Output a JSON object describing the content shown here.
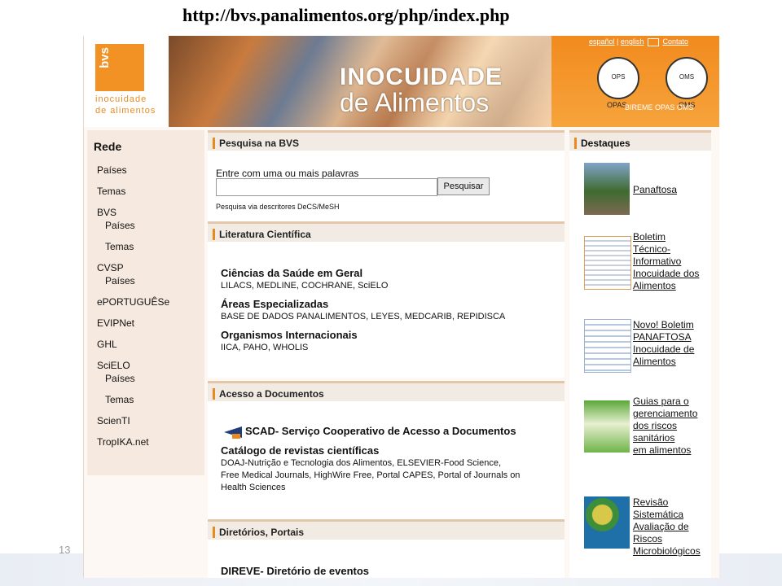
{
  "slide": {
    "url": "http://bvs.panalimentos.org/php/index.php",
    "page_number": "13"
  },
  "banner": {
    "logo_text": "bvs",
    "logo_line1": "inocuidade",
    "logo_line2": "de alimentos",
    "title_line1": "INOCUIDADE",
    "title_line2": "de Alimentos",
    "lang_espanol": "español",
    "lang_separator": "|",
    "lang_english": "english",
    "contact": "Contato",
    "seal1_label": "OPAS",
    "seal2_label": "OMS",
    "seal1_text": "OPS",
    "seal2_text": "OMS",
    "bireme": "BIREME OPAS OMS"
  },
  "leftnav": {
    "header": "Rede",
    "items": [
      "Países",
      "Temas",
      "BVS",
      "Países",
      "Temas",
      "CVSP",
      "Países",
      "ePORTUGUÊSe",
      "EVIPNet",
      "GHL",
      "SciELO",
      "Países",
      "Temas",
      "ScienTI",
      "TropIKA.net"
    ]
  },
  "search": {
    "header": "Pesquisa na BVS",
    "label": "Entre com uma ou mais palavras",
    "input_value": "",
    "button": "Pesquisar",
    "note": "Pesquisa via descritores DeCS/MeSH"
  },
  "literatura": {
    "header": "Literatura Científica",
    "t1": "Ciências da Saúde em Geral",
    "d1": "LILACS, MEDLINE, COCHRANE, SciELO",
    "t2": "Áreas Especializadas",
    "d2": "BASE DE DADOS PANALIMENTOS, LEYES, MEDCARIB, REPIDISCA",
    "t3": "Organismos Internacionais",
    "d3": "IICA, PAHO, WHOLIS"
  },
  "acesso": {
    "header": "Acesso a Documentos",
    "scad": "SCAD- Serviço Cooperativo de Acesso a Documentos",
    "cat_title": "Catálogo de revistas científicas",
    "cat_line1": "DOAJ-Nutrição e Tecnologia dos Alimentos, ELSEVIER-Food Science,",
    "cat_line2": "Free Medical Journals, HighWire Free, Portal CAPES, Portal of Journals on",
    "cat_line3": "Health Sciences"
  },
  "diretorios": {
    "header": "Diretórios, Portais",
    "direve": "DIREVE- Diretório de eventos"
  },
  "destaques": {
    "header": "Destaques",
    "items": [
      {
        "lines": [
          "Panaftosa"
        ]
      },
      {
        "lines": [
          "Boletim",
          "Técnico-",
          "Informativo",
          "Inocuidade dos",
          "Alimentos"
        ]
      },
      {
        "lines": [
          "Novo! Boletim",
          "PANAFTOSA",
          "Inocuidade de",
          "Alimentos"
        ]
      },
      {
        "lines": [
          "Guias para o",
          "gerenciamento",
          "dos riscos",
          "sanitários",
          "em alimentos"
        ]
      },
      {
        "lines": [
          "Revisão",
          "Sistemática",
          "Avaliação de",
          "Riscos",
          "Microbiológicos"
        ]
      }
    ]
  },
  "colors": {
    "accent_orange": "#f28a1e",
    "section_header_bg": "#f1ebe3",
    "nav_bg": "#f6e9df"
  }
}
